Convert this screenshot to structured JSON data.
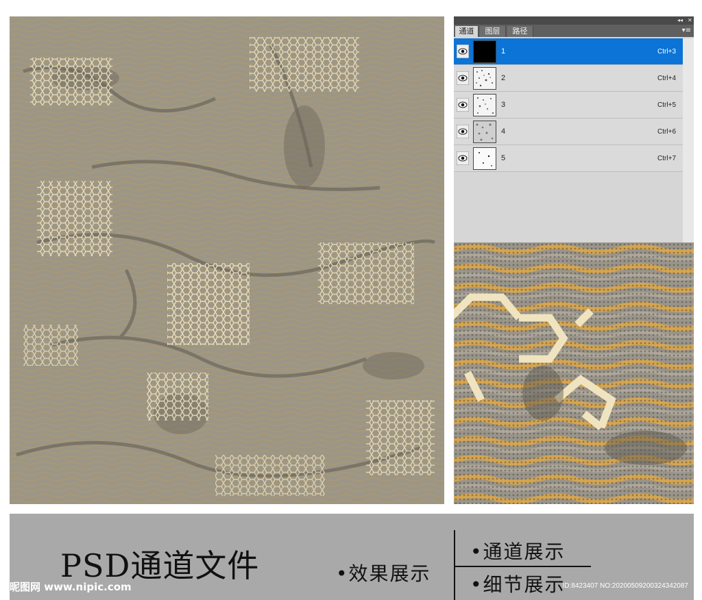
{
  "panel": {
    "tabs": [
      "通道",
      "图层",
      "路径"
    ],
    "active_tab": "通道",
    "channels": [
      {
        "label": "1",
        "shortcut": "Ctrl+3",
        "selected": true
      },
      {
        "label": "2",
        "shortcut": "Ctrl+4",
        "selected": false
      },
      {
        "label": "3",
        "shortcut": "Ctrl+5",
        "selected": false
      },
      {
        "label": "4",
        "shortcut": "Ctrl+6",
        "selected": false
      },
      {
        "label": "5",
        "shortcut": "Ctrl+7",
        "selected": false
      }
    ]
  },
  "footer": {
    "title": "PSD通道文件",
    "effect": "•效果展示",
    "channels": "•通道展示",
    "detail": "•细节展示",
    "watermark_left": "昵图网 www.nipic.com",
    "watermark_right": "ID:8423407 NO:20200509200324342087"
  },
  "colors": {
    "selected_row": "#0b74d6",
    "texture_base": "#9c9686",
    "texture_gold": "#d6a24a",
    "honeycomb": "#f1e6c4",
    "bar": "#a9a9a9"
  }
}
